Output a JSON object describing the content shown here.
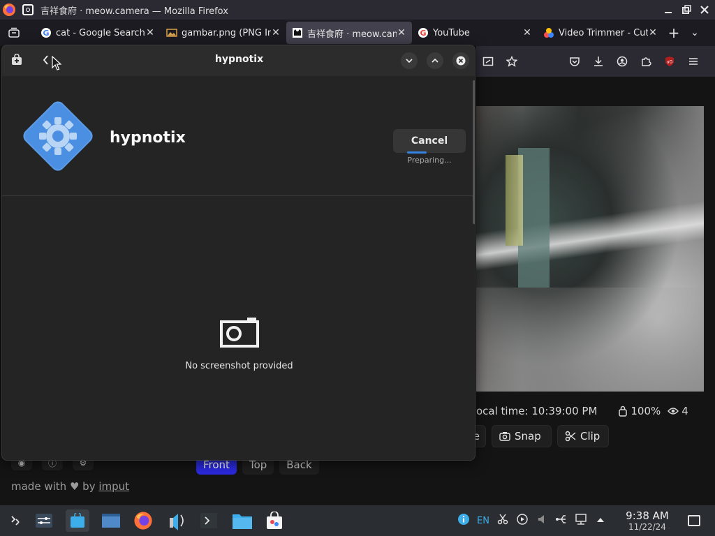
{
  "window": {
    "title": "吉祥食府 · meow.camera — Mozilla Firefox"
  },
  "tabs": [
    {
      "label": "cat - Google Search",
      "icon": "google-icon",
      "active": false
    },
    {
      "label": "gambar.png (PNG Image",
      "icon": "image-icon",
      "active": false
    },
    {
      "label": "吉祥食府 · meow.camera",
      "icon": "meow-camera-icon",
      "active": true
    },
    {
      "label": "YouTube",
      "icon": "google-icon",
      "active": false
    },
    {
      "label": "Video Trimmer - Cut",
      "icon": "video-trimmer-icon",
      "active": false
    }
  ],
  "dialog": {
    "title": "hypnotix",
    "app_name": "hypnotix",
    "cancel_label": "Cancel",
    "status": "Preparing...",
    "no_screenshot": "No screenshot provided"
  },
  "camera": {
    "local_time": "ocal time: 10:39:00 PM",
    "zoom": "100%",
    "viewers": "4",
    "buttons": {
      "partial": "e",
      "snap": "Snap",
      "clip": "Clip"
    }
  },
  "page": {
    "view_tabs": [
      "Front",
      "Top",
      "Back"
    ],
    "made_with_prefix": "made with",
    "made_with_by": "by",
    "made_with_link": "imput"
  },
  "taskbar": {
    "time": "9:38 AM",
    "date": "11/22/24"
  },
  "colors": {
    "accent_blue": "#3584e4",
    "active_view_tab": "#2a2ae0",
    "dialog_bg": "#242424"
  }
}
